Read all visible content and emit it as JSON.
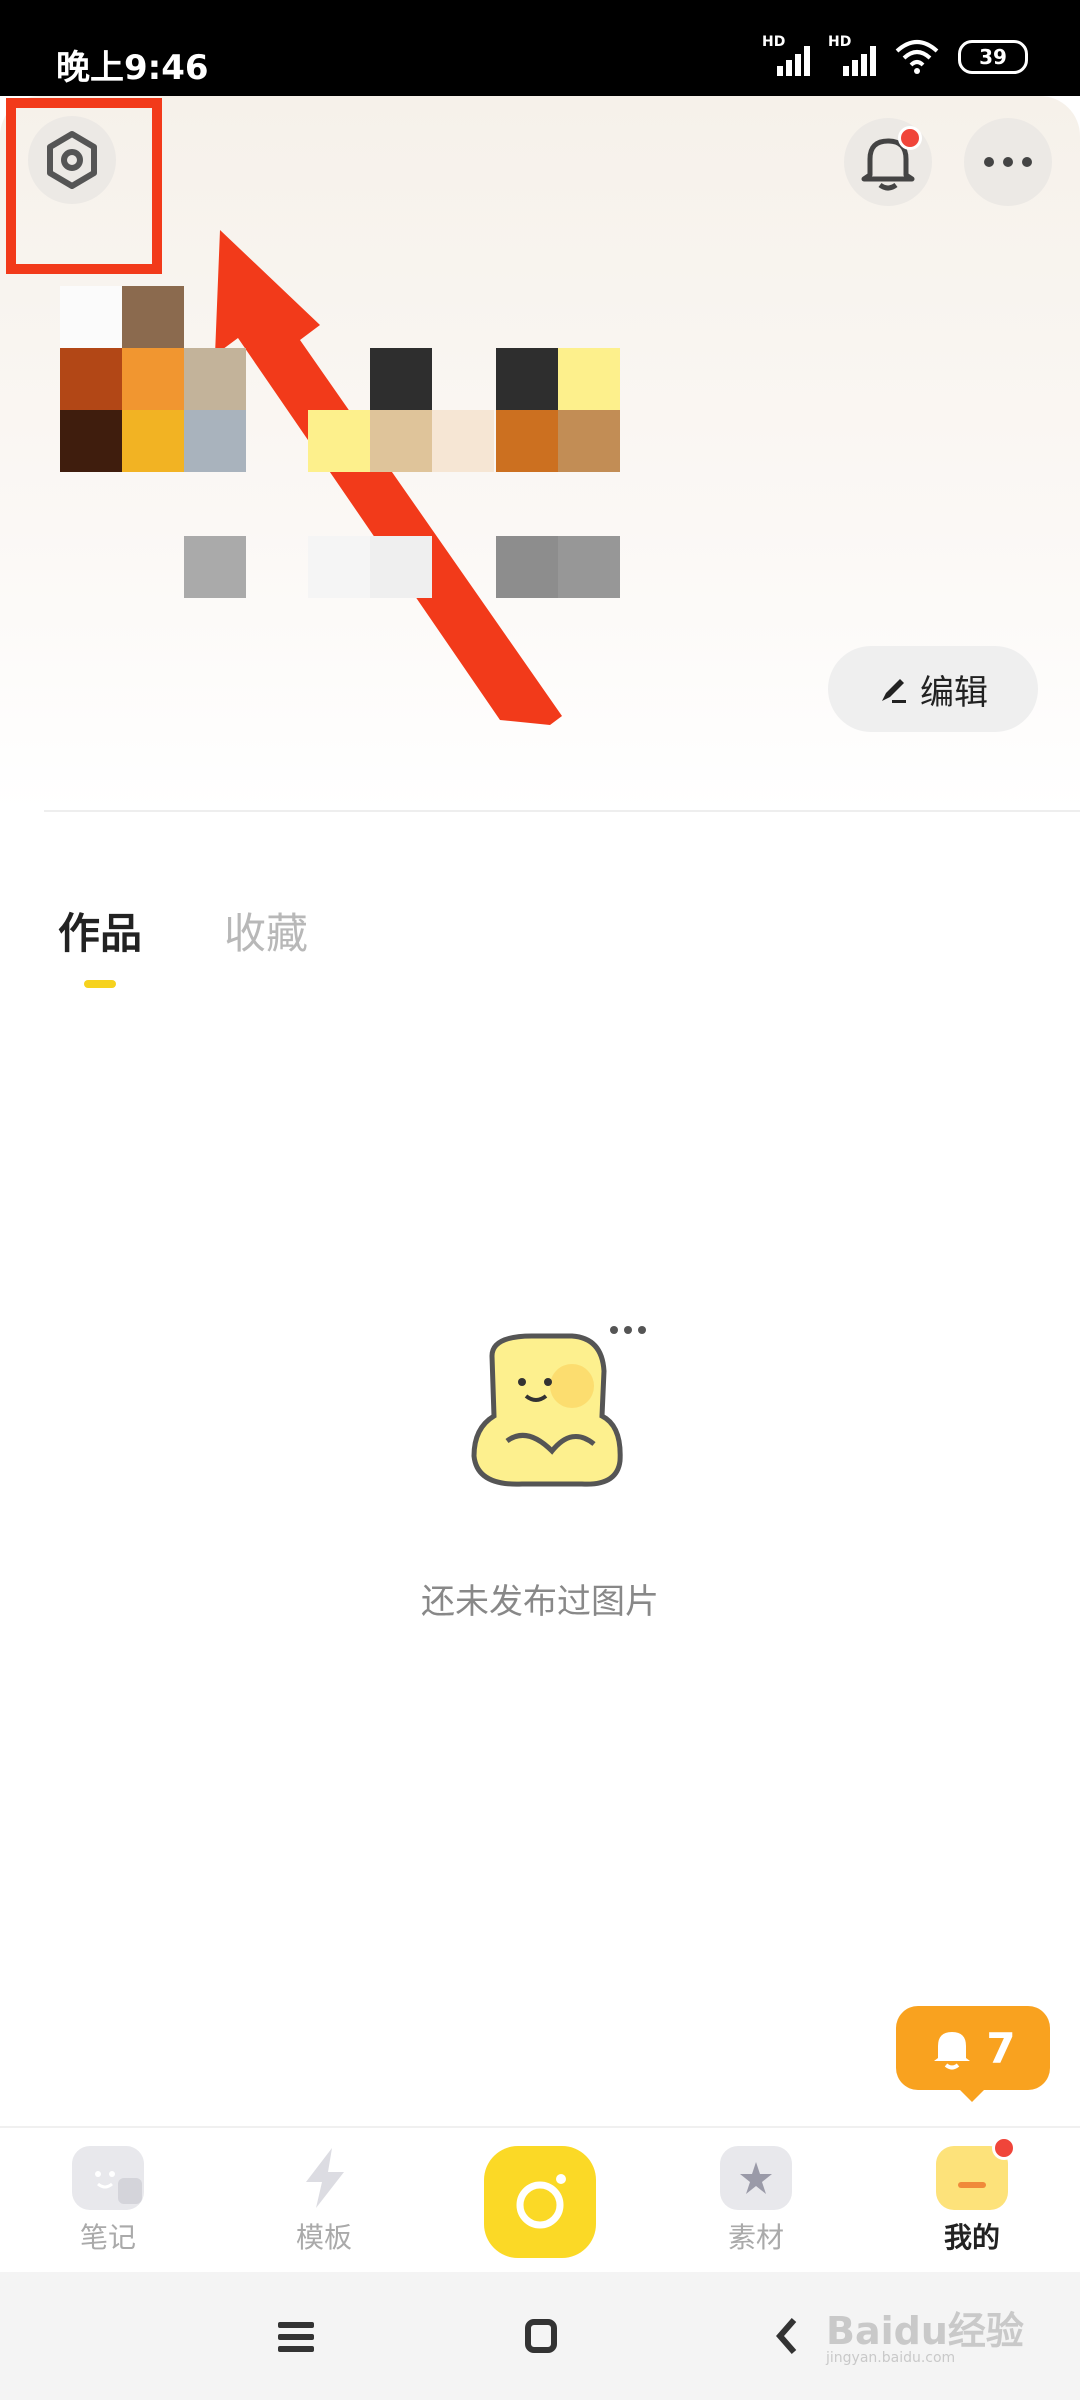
{
  "status_bar": {
    "time": "晚上9:46",
    "battery": "39",
    "hd": "HD"
  },
  "tabs": [
    {
      "label": "作品",
      "active": true
    },
    {
      "label": "收藏",
      "active": false
    }
  ],
  "edit_button": {
    "label": "编辑"
  },
  "empty_state": {
    "text": "还未发布过图片"
  },
  "notification_badge": {
    "count": "7"
  },
  "bottom_nav": [
    {
      "label": "笔记",
      "icon": "notes-icon",
      "active": false
    },
    {
      "label": "模板",
      "icon": "template-icon",
      "active": false
    },
    {
      "label": "",
      "icon": "camera-icon",
      "active": false
    },
    {
      "label": "素材",
      "icon": "material-icon",
      "active": false
    },
    {
      "label": "我的",
      "icon": "me-icon",
      "active": true
    }
  ],
  "watermark": {
    "text": "Baidu经验",
    "sub": "jingyan.baidu.com"
  },
  "colors": {
    "accent_yellow": "#fbd926",
    "badge_orange": "#f9a21f",
    "highlight_red": "#f23a1a",
    "notify_red": "#f0453a"
  }
}
